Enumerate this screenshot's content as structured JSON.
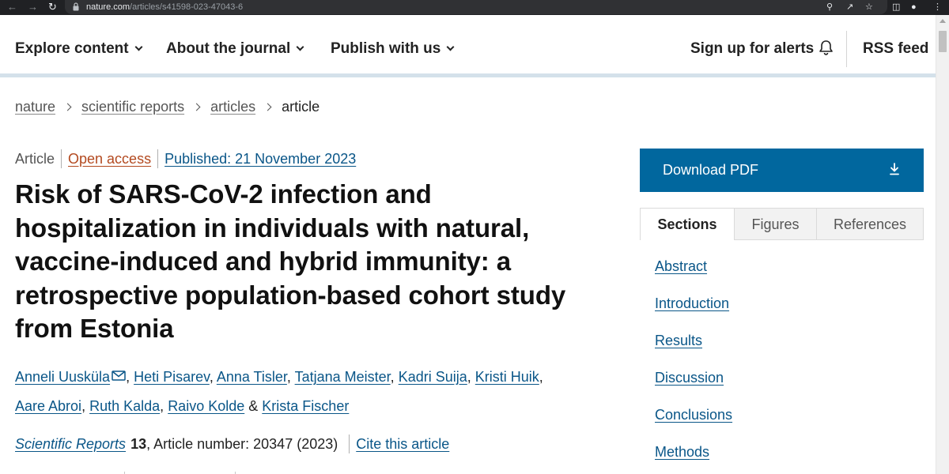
{
  "browser": {
    "url_host": "nature.com",
    "url_path": "/articles/s41598-023-47043-6",
    "icons": [
      "back-icon",
      "forward-icon",
      "reload-icon",
      "lock-icon",
      "zoom-icon",
      "share-icon",
      "bookmark-star-icon",
      "sidebar-icon",
      "profile-icon",
      "menu-icon"
    ]
  },
  "header": {
    "nav": [
      "Explore content",
      "About the journal",
      "Publish with us"
    ],
    "alerts_label": "Sign up for alerts",
    "rss_label": "RSS feed"
  },
  "breadcrumb": [
    "nature",
    "scientific reports",
    "articles",
    "article"
  ],
  "article": {
    "type": "Article",
    "access": "Open access",
    "published": "Published: 21 November 2023",
    "title": "Risk of SARS-CoV-2 infection and hospitalization in individuals with natural, vaccine-induced and hybrid immunity: a retrospective population-based cohort study from Estonia",
    "authors": [
      "Anneli Uusküla",
      "Heti Pisarev",
      "Anna Tisler",
      "Tatjana Meister",
      "Kadri Suija",
      "Kristi Huik",
      "Aare Abroi",
      "Ruth Kalda",
      "Raivo Kolde",
      "Krista Fischer"
    ],
    "author_separator": ",",
    "author_and": "&",
    "journal": "Scientific Reports",
    "volume": "13",
    "article_number_text": ", Article number: 20347 (2023)",
    "cite_label": "Cite this article"
  },
  "sidebar": {
    "download_label": "Download PDF",
    "tabs": [
      "Sections",
      "Figures",
      "References"
    ],
    "active_tab": "Sections",
    "sections": [
      "Abstract",
      "Introduction",
      "Results",
      "Discussion",
      "Conclusions",
      "Methods"
    ]
  },
  "colors": {
    "link": "#0a5688",
    "open_access": "#b3491f",
    "download_button": "#01679e",
    "header_rule": "#d4e1ea"
  }
}
